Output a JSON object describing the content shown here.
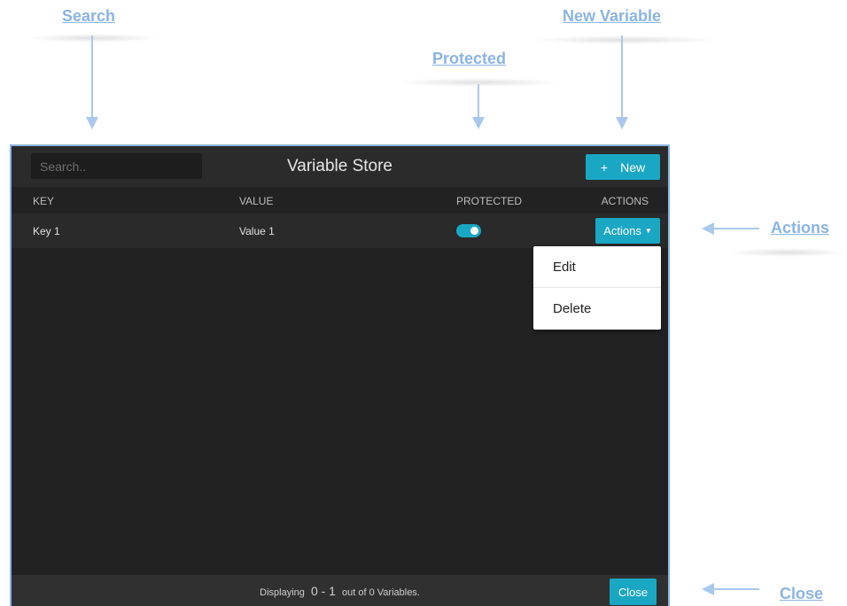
{
  "annotations": {
    "search": "Search",
    "new_variable": "New Variable",
    "protected": "Protected",
    "actions": "Actions",
    "close": "Close"
  },
  "header": {
    "search_placeholder": "Search..",
    "title": "Variable Store",
    "new_icon": "+",
    "new_label": "New"
  },
  "table": {
    "columns": [
      "KEY",
      "VALUE",
      "PROTECTED",
      "ACTIONS"
    ],
    "rows": [
      {
        "key": "Key 1",
        "value": "Value 1",
        "protected": true,
        "actions_label": "Actions"
      }
    ]
  },
  "dropdown": {
    "items": [
      "Edit",
      "Delete"
    ]
  },
  "footer": {
    "prefix": "Displaying",
    "range": "0 - 1",
    "suffix": "out of 0 Variables.",
    "close_label": "Close"
  },
  "colors": {
    "accent": "#1aa7c4",
    "annotation": "#8ab4e3"
  }
}
